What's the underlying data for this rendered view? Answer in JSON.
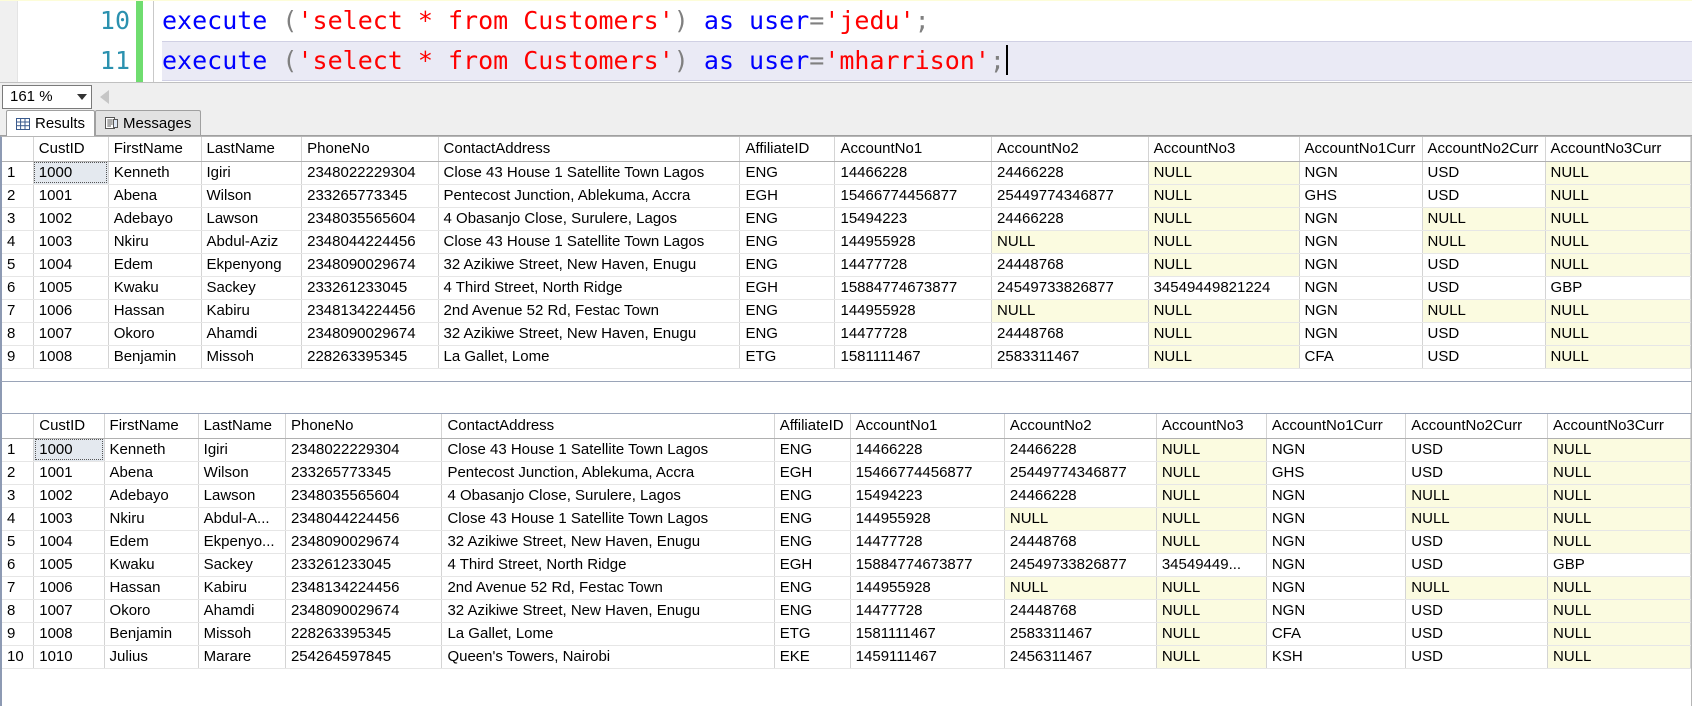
{
  "editor": {
    "lines": [
      {
        "number": "10",
        "current": false,
        "tokens": [
          {
            "t": "kw",
            "v": "execute"
          },
          {
            "t": "pl",
            "v": " "
          },
          {
            "t": "pun",
            "v": "("
          },
          {
            "t": "str",
            "v": "'select * from Customers'"
          },
          {
            "t": "pun",
            "v": ")"
          },
          {
            "t": "pl",
            "v": " "
          },
          {
            "t": "kw",
            "v": "as user"
          },
          {
            "t": "pun",
            "v": "="
          },
          {
            "t": "str",
            "v": "'jedu'"
          },
          {
            "t": "pun",
            "v": ";"
          }
        ]
      },
      {
        "number": "11",
        "current": true,
        "tokens": [
          {
            "t": "kw",
            "v": "execute"
          },
          {
            "t": "pl",
            "v": " "
          },
          {
            "t": "pun",
            "v": "("
          },
          {
            "t": "str",
            "v": "'select * from Customers'"
          },
          {
            "t": "pun",
            "v": ")"
          },
          {
            "t": "pl",
            "v": " "
          },
          {
            "t": "kw",
            "v": "as user"
          },
          {
            "t": "pun",
            "v": "="
          },
          {
            "t": "str",
            "v": "'mharrison'"
          },
          {
            "t": "pun",
            "v": ";"
          }
        ]
      }
    ],
    "full_text_line_10": "execute ('select * from Customers') as user='jedu';",
    "full_text_line_11": "execute ('select * from Customers') as user='mharrison';"
  },
  "zoombar": {
    "zoom_value": "161 %",
    "dropdown_icon": "chevron-down-icon",
    "scroll_left_icon": "triangle-left-icon"
  },
  "tabs": [
    {
      "label": "Results",
      "icon": "grid-icon",
      "active": true
    },
    {
      "label": "Messages",
      "icon": "messages-icon",
      "active": false
    }
  ],
  "colors": {
    "null_cell_bg": "#fbfbe0",
    "selected_cell_bg": "#e4e9ef",
    "keyword": "#0000ff",
    "string": "#ff0000",
    "punctuation": "#808080",
    "line_number": "#2b91af",
    "change_bar": "#6fdd6f"
  },
  "columns": [
    "CustID",
    "FirstName",
    "LastName",
    "PhoneNo",
    "ContactAddress",
    "AffiliateID",
    "AccountNo1",
    "AccountNo2",
    "AccountNo3",
    "AccountNo1Curr",
    "AccountNo2Curr",
    "AccountNo3Curr"
  ],
  "grid1": {
    "name": "results-grid-jedu",
    "columns": [
      "CustID",
      "FirstName",
      "LastName",
      "PhoneNo",
      "ContactAddress",
      "AffiliateID",
      "AccountNo1",
      "AccountNo2",
      "AccountNo3",
      "AccountNo1Curr",
      "AccountNo2Curr",
      "AccountNo3Curr"
    ],
    "rows": [
      {
        "n": "1",
        "cells": [
          "1000",
          "Kenneth",
          "Igiri",
          "2348022229304",
          "Close 43 House 1 Satellite Town Lagos",
          "ENG",
          "14466228",
          "24466228",
          "NULL",
          "NGN",
          "USD",
          "NULL"
        ]
      },
      {
        "n": "2",
        "cells": [
          "1001",
          "Abena",
          "Wilson",
          "233265773345",
          "Pentecost Junction, Ablekuma, Accra",
          "EGH",
          "15466774456877",
          "25449774346877",
          "NULL",
          "GHS",
          "USD",
          "NULL"
        ]
      },
      {
        "n": "3",
        "cells": [
          "1002",
          "Adebayo",
          "Lawson",
          "2348035565604",
          "4 Obasanjo Close, Surulere, Lagos",
          "ENG",
          "15494223",
          "24466228",
          "NULL",
          "NGN",
          "NULL",
          "NULL"
        ]
      },
      {
        "n": "4",
        "cells": [
          "1003",
          "Nkiru",
          "Abdul-Aziz",
          "2348044224456",
          "Close 43 House 1 Satellite Town Lagos",
          "ENG",
          "144955928",
          "NULL",
          "NULL",
          "NGN",
          "NULL",
          "NULL"
        ]
      },
      {
        "n": "5",
        "cells": [
          "1004",
          "Edem",
          "Ekpenyong",
          "2348090029674",
          "32 Azikiwe Street, New Haven, Enugu",
          "ENG",
          "14477728",
          "24448768",
          "NULL",
          "NGN",
          "USD",
          "NULL"
        ]
      },
      {
        "n": "6",
        "cells": [
          "1005",
          "Kwaku",
          "Sackey",
          "233261233045",
          "4 Third Street, North Ridge",
          "EGH",
          "15884774673877",
          "24549733826877",
          "34549449821224",
          "NGN",
          "USD",
          "GBP"
        ]
      },
      {
        "n": "7",
        "cells": [
          "1006",
          "Hassan",
          "Kabiru",
          "2348134224456",
          "2nd Avenue 52 Rd, Festac Town",
          "ENG",
          "144955928",
          "NULL",
          "NULL",
          "NGN",
          "NULL",
          "NULL"
        ]
      },
      {
        "n": "8",
        "cells": [
          "1007",
          "Okoro",
          "Ahamdi",
          "2348090029674",
          "32 Azikiwe Street, New Haven, Enugu",
          "ENG",
          "14477728",
          "24448768",
          "NULL",
          "NGN",
          "USD",
          "NULL"
        ]
      },
      {
        "n": "9",
        "cells": [
          "1008",
          "Benjamin",
          "Missoh",
          "228263395345",
          "La Gallet, Lome",
          "ETG",
          "1581111467",
          "2583311467",
          "NULL",
          "CFA",
          "USD",
          "NULL"
        ]
      }
    ]
  },
  "grid2": {
    "name": "results-grid-mharrison",
    "columns": [
      "CustID",
      "FirstName",
      "LastName",
      "PhoneNo",
      "ContactAddress",
      "AffiliateID",
      "AccountNo1",
      "AccountNo2",
      "AccountNo3",
      "AccountNo1Curr",
      "AccountNo2Curr",
      "AccountNo3Curr"
    ],
    "rows": [
      {
        "n": "1",
        "cells": [
          "1000",
          "Kenneth",
          "Igiri",
          "2348022229304",
          "Close 43 House 1 Satellite Town Lagos",
          "ENG",
          "14466228",
          "24466228",
          "NULL",
          "NGN",
          "USD",
          "NULL"
        ]
      },
      {
        "n": "2",
        "cells": [
          "1001",
          "Abena",
          "Wilson",
          "233265773345",
          "Pentecost Junction, Ablekuma, Accra",
          "EGH",
          "15466774456877",
          "25449774346877",
          "NULL",
          "GHS",
          "USD",
          "NULL"
        ]
      },
      {
        "n": "3",
        "cells": [
          "1002",
          "Adebayo",
          "Lawson",
          "2348035565604",
          "4 Obasanjo Close, Surulere, Lagos",
          "ENG",
          "15494223",
          "24466228",
          "NULL",
          "NGN",
          "NULL",
          "NULL"
        ]
      },
      {
        "n": "4",
        "cells": [
          "1003",
          "Nkiru",
          "Abdul-A...",
          "2348044224456",
          "Close 43 House 1 Satellite Town Lagos",
          "ENG",
          "144955928",
          "NULL",
          "NULL",
          "NGN",
          "NULL",
          "NULL"
        ]
      },
      {
        "n": "5",
        "cells": [
          "1004",
          "Edem",
          "Ekpenyo...",
          "2348090029674",
          "32 Azikiwe Street, New Haven, Enugu",
          "ENG",
          "14477728",
          "24448768",
          "NULL",
          "NGN",
          "USD",
          "NULL"
        ]
      },
      {
        "n": "6",
        "cells": [
          "1005",
          "Kwaku",
          "Sackey",
          "233261233045",
          "4 Third Street, North Ridge",
          "EGH",
          "15884774673877",
          "24549733826877",
          "34549449...",
          "NGN",
          "USD",
          "GBP"
        ]
      },
      {
        "n": "7",
        "cells": [
          "1006",
          "Hassan",
          "Kabiru",
          "2348134224456",
          "2nd Avenue 52 Rd, Festac Town",
          "ENG",
          "144955928",
          "NULL",
          "NULL",
          "NGN",
          "NULL",
          "NULL"
        ]
      },
      {
        "n": "8",
        "cells": [
          "1007",
          "Okoro",
          "Ahamdi",
          "2348090029674",
          "32 Azikiwe Street, New Haven, Enugu",
          "ENG",
          "14477728",
          "24448768",
          "NULL",
          "NGN",
          "USD",
          "NULL"
        ]
      },
      {
        "n": "9",
        "cells": [
          "1008",
          "Benjamin",
          "Missoh",
          "228263395345",
          "La Gallet, Lome",
          "ETG",
          "1581111467",
          "2583311467",
          "NULL",
          "CFA",
          "USD",
          "NULL"
        ]
      },
      {
        "n": "10",
        "cells": [
          "1010",
          "Julius",
          "Marare",
          "254264597845",
          "Queen's Towers, Nairobi",
          "EKE",
          "1459111467",
          "2456311467",
          "NULL",
          "KSH",
          "USD",
          "NULL"
        ]
      }
    ]
  }
}
